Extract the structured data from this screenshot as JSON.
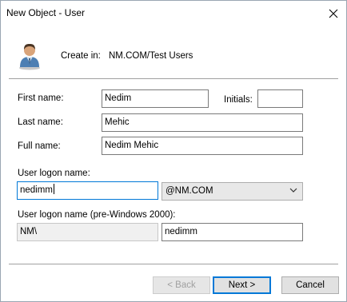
{
  "window": {
    "title": "New Object - User",
    "close_icon": "close-icon"
  },
  "header": {
    "icon": "user-icon",
    "create_in_label": "Create in:",
    "create_in_value": "NM.COM/Test Users"
  },
  "form": {
    "first_name_label": "First name:",
    "first_name_value": "Nedim",
    "initials_label": "Initials:",
    "initials_value": "",
    "last_name_label": "Last name:",
    "last_name_value": "Mehic",
    "full_name_label": "Full name:",
    "full_name_value": "Nedim Mehic",
    "logon_name_label": "User logon name:",
    "logon_name_value": "nedimm",
    "domain_selected": "@NM.COM",
    "pre2000_label": "User logon name (pre-Windows 2000):",
    "pre2000_domain": "NM\\",
    "pre2000_value": "nedimm"
  },
  "buttons": {
    "back": "< Back",
    "next": "Next >",
    "cancel": "Cancel"
  },
  "colors": {
    "focus_border": "#0078d7",
    "button_face": "#e1e1e1",
    "disabled_text": "#a0a0a0"
  }
}
